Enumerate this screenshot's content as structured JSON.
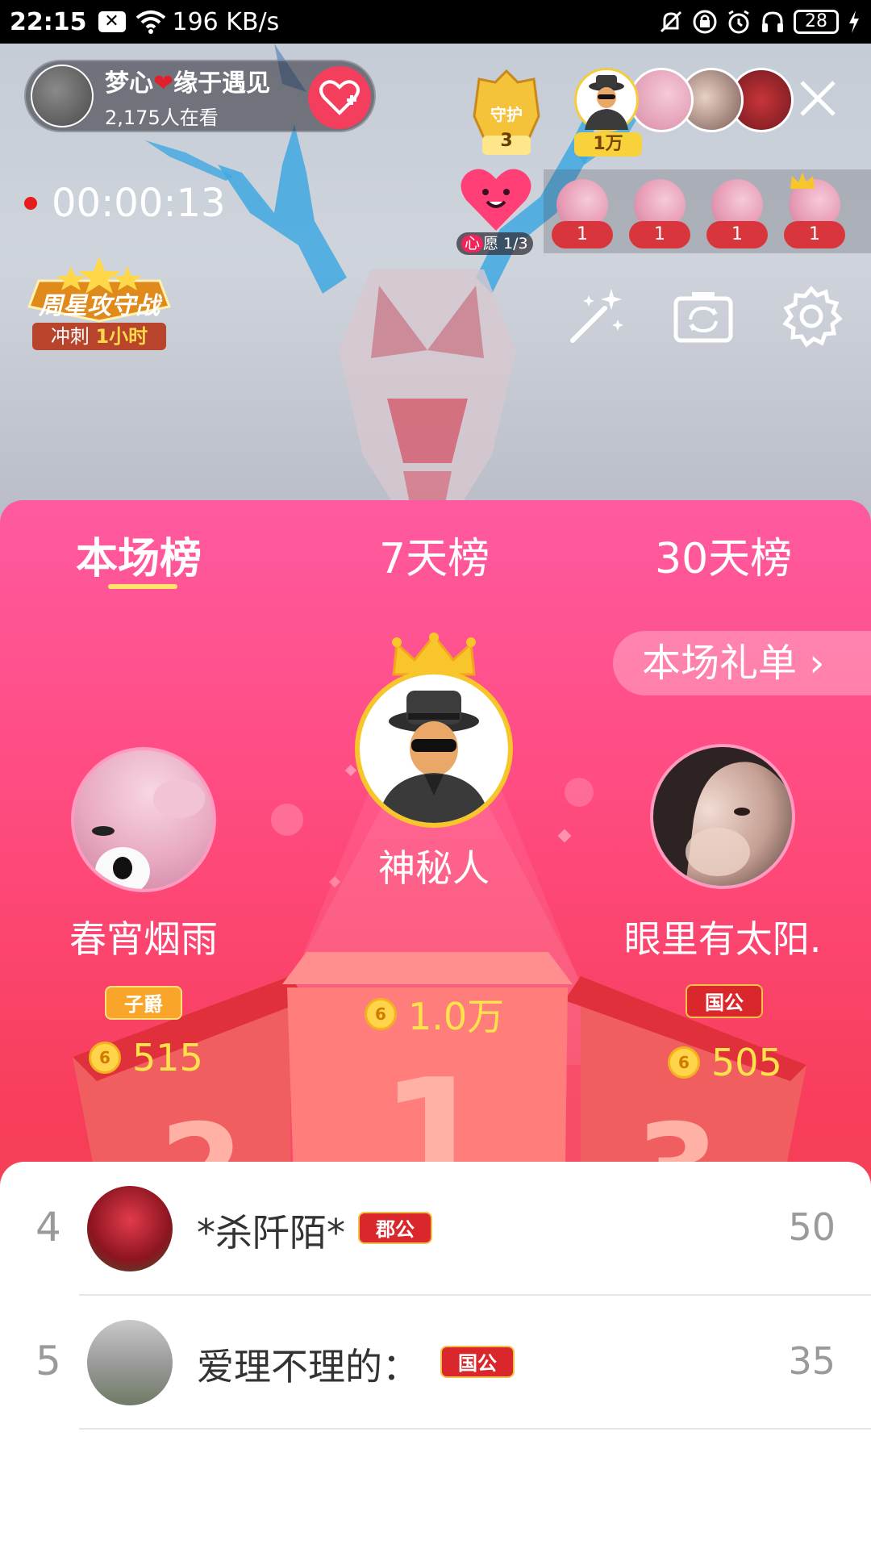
{
  "status_bar": {
    "time": "22:15",
    "notif_icon": "x-box-icon",
    "network_speed": "196 KB/s",
    "battery": "28"
  },
  "live": {
    "host_name": "梦心",
    "host_name_suffix": "缘于遇见",
    "viewer_count": "2,175人在看",
    "guard_label": "守护",
    "guard_count": "3",
    "top_viewer_amount": "1万",
    "record_time": "00:00:13",
    "wish_prefix": "心",
    "wish_text": "愿 1/3",
    "gift_counts": [
      "1",
      "1",
      "1",
      "1"
    ],
    "week_star_title": "周星攻守战",
    "week_star_sub_prefix": "冲刺",
    "week_star_sub_value": "1小时"
  },
  "ranking": {
    "tabs": [
      "本场榜",
      "7天榜",
      "30天榜"
    ],
    "active_tab": 0,
    "gift_list_button": "本场礼单 ›",
    "first": {
      "name": "神秘人",
      "score": "1.0万"
    },
    "second": {
      "name": "春宵烟雨",
      "title": "子爵",
      "score": "515"
    },
    "third": {
      "name": "眼里有太阳.",
      "title": "国公",
      "score": "505"
    },
    "podium_numbers": [
      "1",
      "2",
      "3"
    ],
    "coin_glyph": "6"
  },
  "list": [
    {
      "rank": "4",
      "name": "*杀阡陌*",
      "badge": "郡公",
      "score": "50"
    },
    {
      "rank": "5",
      "name": "爱理不理的：",
      "badge": "国公",
      "score": "35"
    }
  ],
  "colors": {
    "panel_top": "#ff5aa0",
    "panel_bottom": "#f5525a",
    "accent_yellow": "#ffe34a",
    "badge_red": "#d9272b"
  }
}
